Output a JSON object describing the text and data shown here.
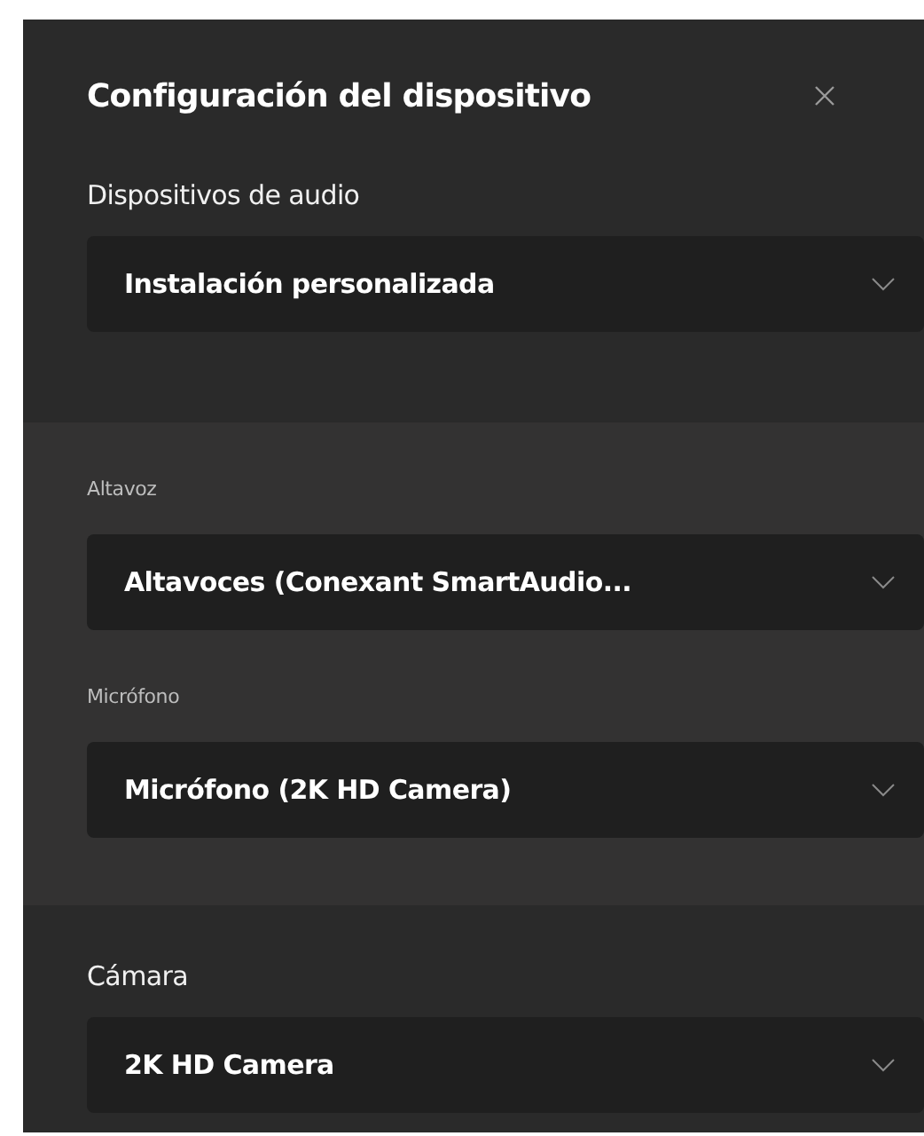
{
  "panel": {
    "title": "Configuración del dispositivo",
    "audio_devices": {
      "label": "Dispositivos de audio",
      "value": "Instalación personalizada"
    },
    "custom_devices": [
      {
        "label": "Altavoz",
        "value": "Altavoces (Conexant SmartAudio..."
      },
      {
        "label": "Micrófono",
        "value": "Micrófono (2K HD Camera)"
      }
    ],
    "camera": {
      "label": "Cámara",
      "value": "2K HD Camera"
    }
  }
}
